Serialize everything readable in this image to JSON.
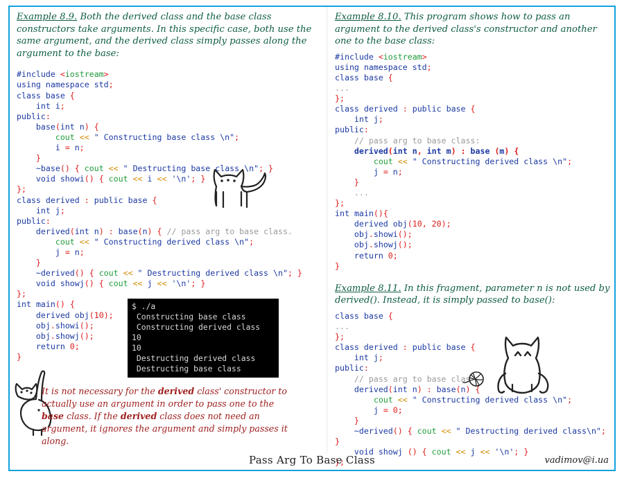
{
  "theme": {
    "frame_color": "#12a0dd",
    "prose_color": "#0e5c46",
    "note_color": "#a02020",
    "terminal_bg": "#000000",
    "terminal_fg": "#d8d8d8"
  },
  "left": {
    "heading_lead": "Example 8.9.",
    "heading_rest": " Both the derived class and the base class constructors take arguments. In this specific case, both use the same argument, and the derived class simply passes along the argument to the base:",
    "code_lines": [
      "#include <iostream>",
      "using namespace std;",
      "class base {",
      "    int i;",
      "public:",
      "    base(int n) {",
      "        cout << \" Constructing base class \\n\";",
      "        i = n;",
      "    }",
      "    ~base() { cout << \" Destructing base class \\n\"; }",
      "    void showi() { cout << i << '\\n'; }",
      "};",
      "class derived : public base {",
      "    int j;",
      "public:",
      "    derived(int n) : base(n) { // pass arg to base class.",
      "        cout << \" Constructing derived class \\n\";",
      "        j = n;",
      "    }",
      "    ~derived() { cout << \" Destructing derived class \\n\"; }",
      "    void showj() { cout << j << '\\n'; }",
      "};",
      "int main() {",
      "    derived obj(10);",
      "    obj.showi();",
      "    obj.showj();",
      "    return 0;",
      "}"
    ],
    "terminal_lines": [
      "$ ./a",
      " Constructing base class",
      " Constructing derived class",
      "10",
      "10",
      " Destructing derived class",
      " Destructing base class"
    ],
    "note_parts": [
      {
        "text": "It is not necessary for the ",
        "bold": false
      },
      {
        "text": "derived",
        "bold": true
      },
      {
        "text": " class' constructor to actually use an argument in order to pass one to the ",
        "bold": false
      },
      {
        "text": "base",
        "bold": true
      },
      {
        "text": " class. If the ",
        "bold": false
      },
      {
        "text": "derived",
        "bold": true
      },
      {
        "text": " class does not need an argument, it ignores the argument and simply passes it along.",
        "bold": false
      }
    ]
  },
  "right": {
    "heading1_lead": "Example 8.10.",
    "heading1_rest": " This program shows how to pass an argument to the derived class's constructor and another one to the base class:",
    "code1_lines": [
      "#include <iostream>",
      "using namespace std;",
      "class base {",
      "...",
      "};",
      "class derived : public base {",
      "    int j;",
      "public:",
      "    // pass arg to base class:",
      "    derived(int n, int m) : base (m) {",
      "        cout << \" Constructing derived class \\n\";",
      "        j = n;",
      "    }",
      "    ...",
      "};",
      "int main(){",
      "    derived obj(10, 20);",
      "    obj.showi();",
      "    obj.showj();",
      "    return 0;",
      "}"
    ],
    "heading2_lead": "Example 8.11.",
    "heading2_rest": " In this fragment, parameter n is not used by derived(). Instead, it is simply passed to base():",
    "code2_lines": [
      "class base {",
      "...",
      "};",
      "class derived : public base {",
      "    int j;",
      "public:",
      "    // pass arg to base class:",
      "    derived(int n) : base(n) {",
      "        cout << \" Constructing derived class \\n\";",
      "        j = 0;",
      "    }",
      "    ~derived() { cout << \" Destructing derived class\\n\";",
      "}",
      "    void showj () { cout << j << '\\n'; }",
      "};"
    ]
  },
  "footer": {
    "title": "Pass Arg To Base Class",
    "email": "vadimov@i.ua"
  },
  "icons": {
    "cat_standing": "cat-standing-icon",
    "cat_back": "cat-from-behind-icon",
    "cat_sitting": "cat-sitting-icon",
    "yarn_ball": "yarn-ball-icon"
  }
}
